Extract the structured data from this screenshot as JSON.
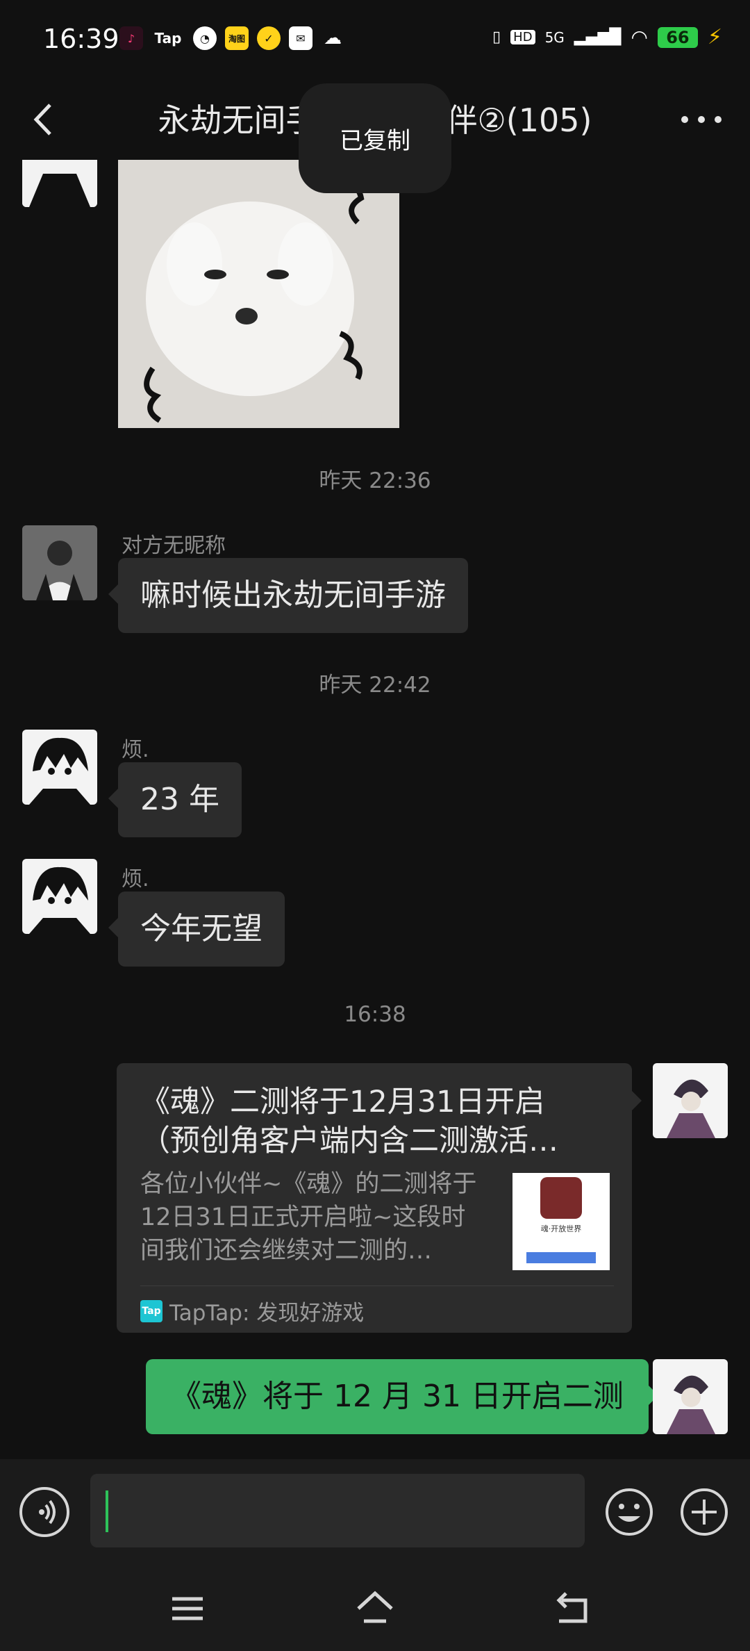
{
  "status_bar": {
    "time": "16:39",
    "apps": [
      {
        "icon": "tiktok-icon",
        "label": "",
        "color": "#d6216a"
      },
      {
        "icon": "tap-icon",
        "label": "Tap",
        "color": "#111111"
      },
      {
        "icon": "speedometer-icon",
        "label": "",
        "color": "#ffffff"
      },
      {
        "icon": "taobao-icon",
        "label": "淘图",
        "color": "#ffd21a"
      },
      {
        "icon": "check-icon",
        "label": "",
        "color": "#ffd21a"
      },
      {
        "icon": "mail-icon",
        "label": "",
        "color": "#ffffff"
      },
      {
        "icon": "wechat-icon",
        "label": "",
        "color": "#ffffff"
      }
    ],
    "hd": "HD",
    "network": "5G",
    "battery": "66"
  },
  "header": {
    "title": "永劫无间手游预约伙伴②(105)",
    "back_icon": "chevron-left-icon",
    "more_icon": "more-icon"
  },
  "toast": "已复制",
  "messages": {
    "time_1": "昨天 22:36",
    "msg_1_sender": "对方无昵称",
    "msg_1_text": "嘛时候出永劫无间手游",
    "time_2": "昨天 22:42",
    "msg_2_sender": "烦.",
    "msg_2_text": "23 年",
    "msg_3_sender": "烦.",
    "msg_3_text": "今年无望",
    "time_3": "16:38",
    "card": {
      "title": "《魂》二测将于12月31日开启（预创角客户端内含二测激活…",
      "desc": "各位小伙伴~《魂》的二测将于12日31日正式开启啦~这段时间我们还会继续对二测的…",
      "source": "TapTap: 发现好游戏",
      "thumb_text": "魂·开放世界"
    },
    "msg_5_text": "《魂》将于 12 月 31 日开启二测"
  },
  "input": {
    "voice_icon": "voice-icon",
    "emoji_icon": "emoji-icon",
    "plus_icon": "plus-icon"
  },
  "nav": {
    "menu_icon": "menu-icon",
    "home_icon": "home-icon",
    "back_icon": "back-icon"
  },
  "colors": {
    "background": "#111111",
    "bubble": "#2c2c2c",
    "green_bubble": "#3ab164",
    "accent": "#2ec25a"
  }
}
